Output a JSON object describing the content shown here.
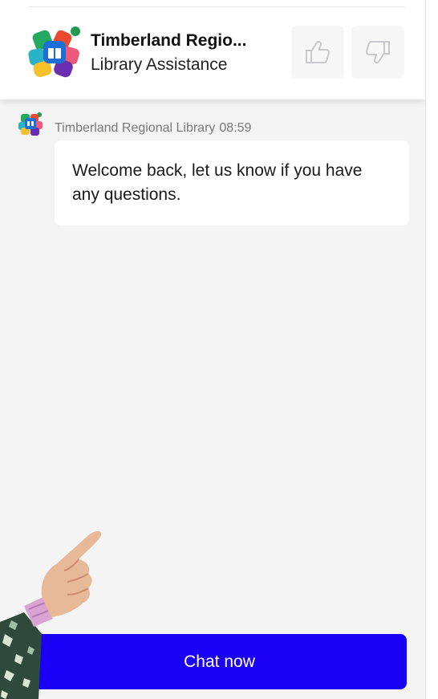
{
  "header": {
    "title": "Timberland Regio...",
    "subtitle": "Library Assistance",
    "logo_icon": "library-logo-icon",
    "thumbs_up_icon": "thumbs-up-icon",
    "thumbs_down_icon": "thumbs-down-icon"
  },
  "messages": [
    {
      "sender": "Timberland Regional Library",
      "time": "08:59",
      "text": "Welcome back, let us know if you have any questions."
    }
  ],
  "chat_button": {
    "label": "Chat now"
  },
  "colors": {
    "accent": "#1a00f5",
    "background": "#f4f4f5",
    "bubble": "#ffffff"
  }
}
